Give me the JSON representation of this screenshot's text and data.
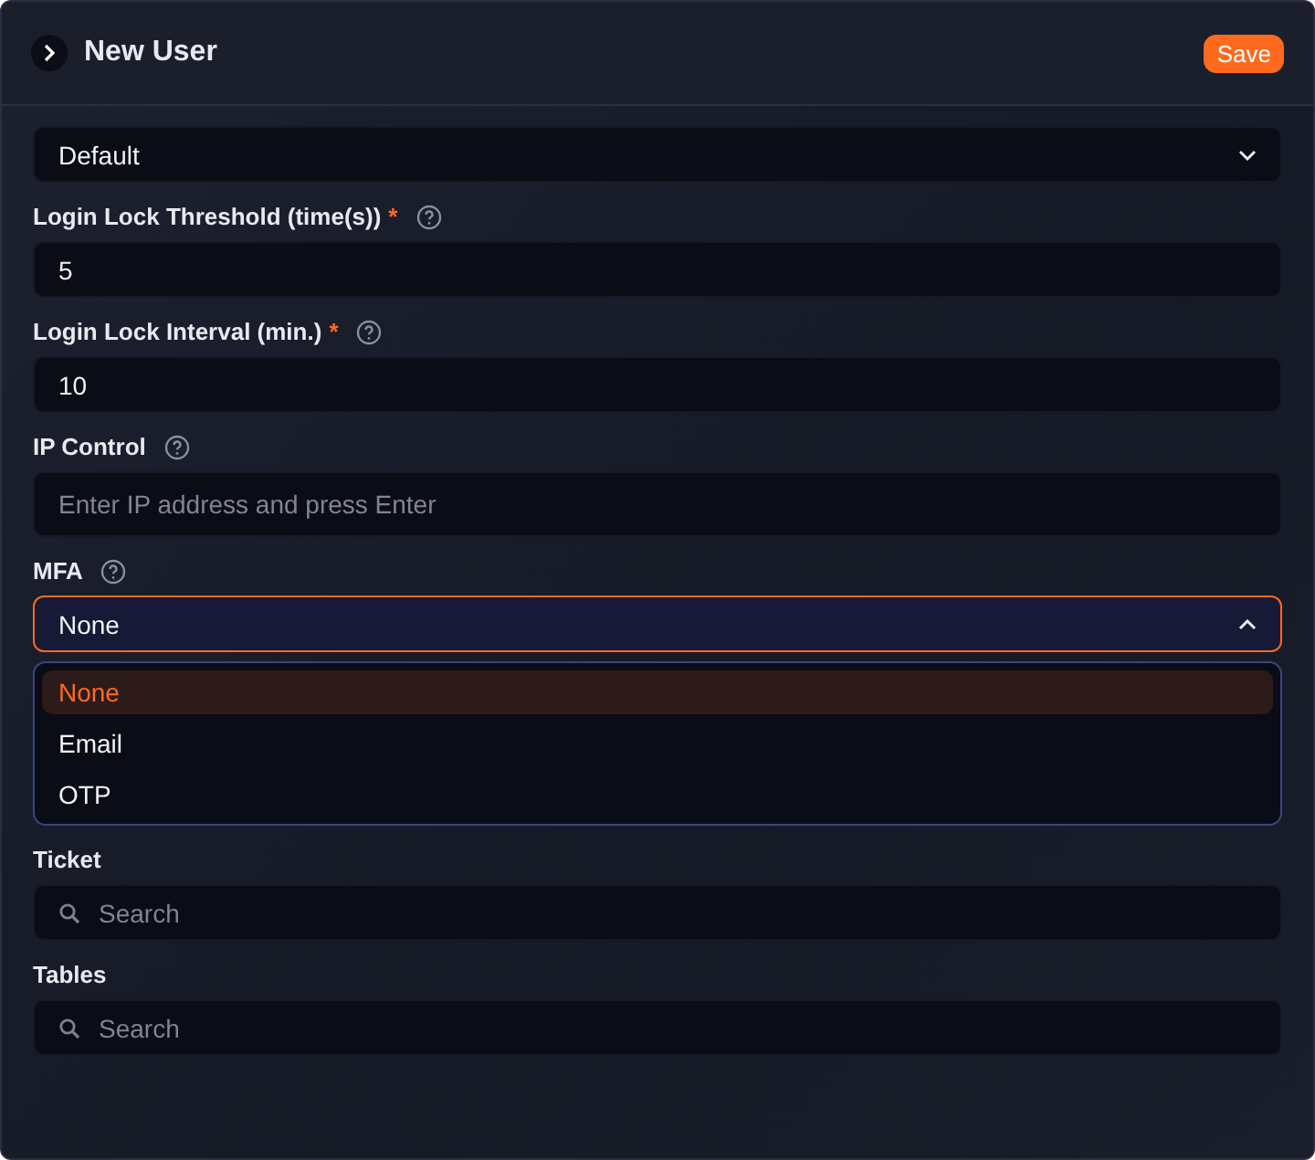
{
  "header": {
    "title": "New User",
    "save_button": "Save"
  },
  "fields": [
    {
      "kind": "select",
      "value": "Default",
      "expanded": false
    },
    {
      "kind": "input",
      "label": "Login Lock Threshold (time(s))",
      "required_mark": "*",
      "help": true,
      "value": "5"
    },
    {
      "kind": "input",
      "label": "Login Lock Interval (min.)",
      "required_mark": "*",
      "help": true,
      "value": "10"
    },
    {
      "kind": "input",
      "label": "IP Control",
      "help": true,
      "placeholder": "Enter IP address and press Enter"
    },
    {
      "kind": "select",
      "label": "MFA",
      "help": true,
      "value": "None",
      "expanded": true,
      "options": [
        {
          "label": "None",
          "selected": true
        },
        {
          "label": "Email",
          "selected": false
        },
        {
          "label": "OTP",
          "selected": false
        }
      ]
    },
    {
      "kind": "search",
      "label": "Ticket",
      "help": false,
      "placeholder": "Search"
    },
    {
      "kind": "search",
      "label": "Tables",
      "help": false,
      "placeholder": "Search"
    }
  ]
}
